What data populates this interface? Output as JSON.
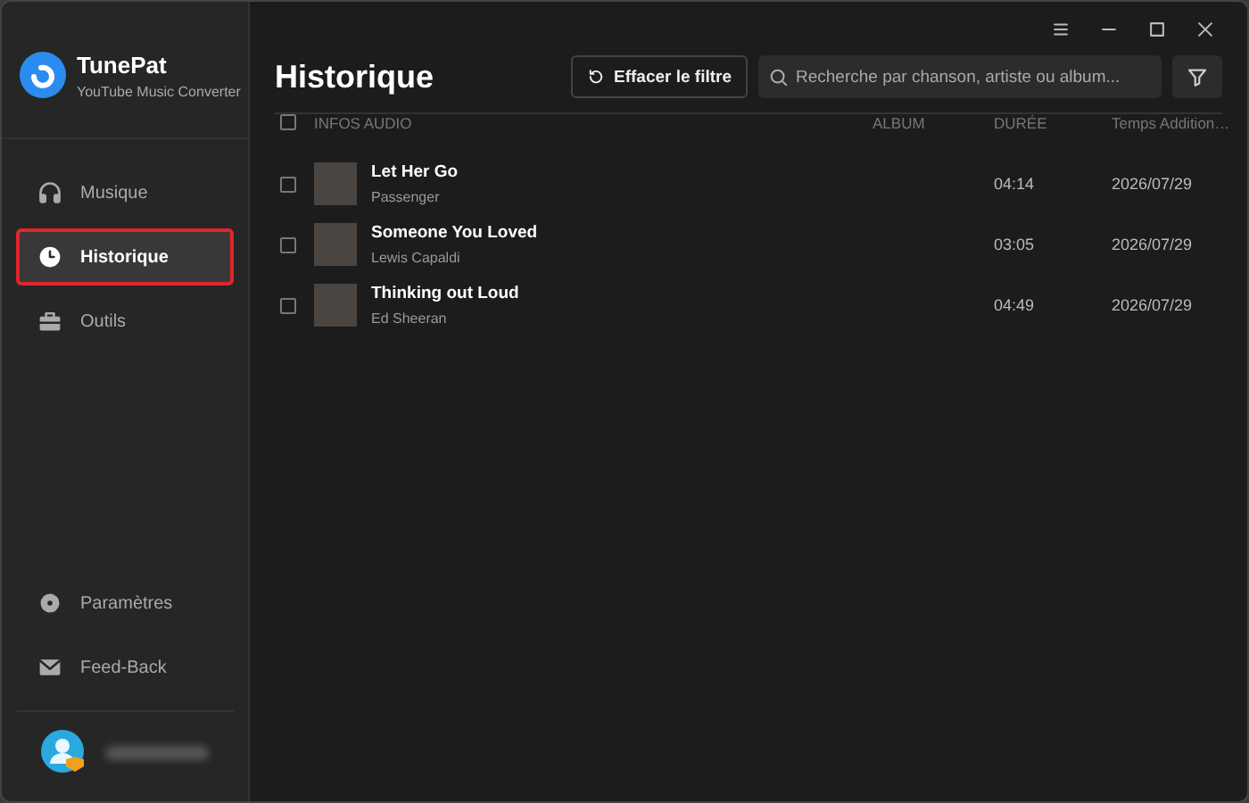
{
  "app": {
    "name": "TunePat",
    "subtitle": "YouTube Music Converter"
  },
  "sidebar": {
    "items": [
      {
        "label": "Musique",
        "kind": "music",
        "selected": false
      },
      {
        "label": "Historique",
        "kind": "history",
        "selected": true
      },
      {
        "label": "Outils",
        "kind": "tools",
        "selected": false
      }
    ],
    "bottom_items": [
      {
        "label": "Paramètres",
        "kind": "settings"
      },
      {
        "label": "Feed-Back",
        "kind": "feedback"
      }
    ]
  },
  "page_title": "Historique",
  "clear_filter_button": "Effacer le filtre",
  "search": {
    "placeholder": "Recherche par chanson, artiste ou album..."
  },
  "table": {
    "all_checked": false,
    "columns": [
      "INFOS AUDIO",
      "ALBUM",
      "DURÉE",
      "Temps Addition…"
    ],
    "rows": [
      {
        "title": "Let Her Go",
        "artist": "Passenger",
        "duration": "04:14",
        "added": "2026/07/29",
        "checked": false
      },
      {
        "title": "Someone You Loved",
        "artist": "Lewis Capaldi",
        "duration": "03:05",
        "added": "2026/07/29",
        "checked": false
      },
      {
        "title": "Thinking out Loud",
        "artist": "Ed Sheeran",
        "duration": "04:49",
        "added": "2026/07/29",
        "checked": false
      }
    ]
  }
}
